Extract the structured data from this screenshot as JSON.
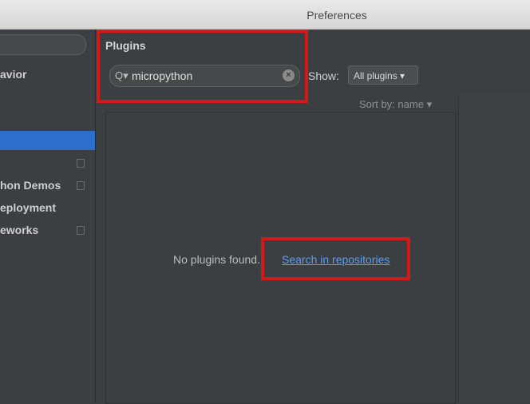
{
  "window": {
    "title": "Preferences"
  },
  "sidebar": {
    "items": [
      {
        "label": "avior",
        "selected": false,
        "copy_icon": false
      },
      {
        "label": "",
        "selected": true,
        "copy_icon": false
      },
      {
        "label": "",
        "selected": false,
        "copy_icon": true
      },
      {
        "label": "hon Demos",
        "selected": false,
        "copy_icon": true
      },
      {
        "label": "eployment",
        "selected": false,
        "copy_icon": false
      },
      {
        "label": "eworks",
        "selected": false,
        "copy_icon": true
      }
    ]
  },
  "plugins": {
    "title": "Plugins",
    "search": {
      "value": "micropython",
      "icon": "search-icon"
    },
    "show": {
      "label": "Show:",
      "selected": "All plugins"
    },
    "sort_by": "Sort by: name",
    "empty_message": "No plugins found.",
    "repo_link": "Search in repositories"
  },
  "colors": {
    "highlight": "#d21a1a",
    "selection": "#2d6dcc",
    "link": "#589df6"
  }
}
